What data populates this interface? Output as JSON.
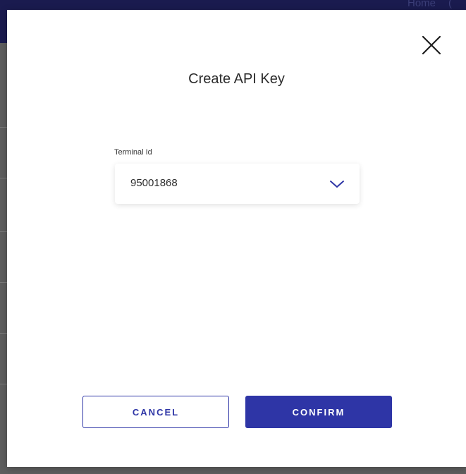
{
  "background": {
    "nav_items": [
      "Home",
      "("
    ]
  },
  "modal": {
    "title": "Create API Key",
    "close_icon": "close-icon",
    "terminal": {
      "label": "Terminal Id",
      "selected_value": "95001868",
      "dropdown_icon": "chevron-down-icon"
    },
    "buttons": {
      "cancel_label": "CANCEL",
      "confirm_label": "CONFIRM"
    }
  },
  "colors": {
    "accent": "#2e35a6",
    "topbar": "#1a1b4f",
    "overlay": "#5e5e5e"
  }
}
